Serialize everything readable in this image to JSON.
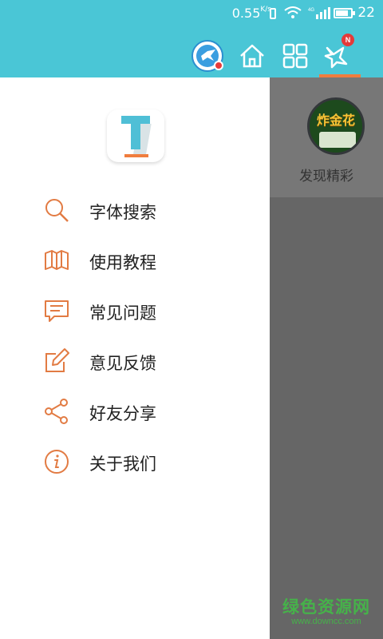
{
  "status_bar": {
    "speed_value": "0.55",
    "speed_unit": "K/s",
    "network_label": "4G",
    "time": "22"
  },
  "toolbar": {
    "icons": [
      "avatar-icon",
      "home-icon",
      "grid-icon",
      "notice-icon"
    ],
    "notice_badge": "N",
    "accent_color": "#f07d3e",
    "header_color": "#4ac6d6"
  },
  "drawer": {
    "logo_letter": "T",
    "items": [
      {
        "label": "字体搜索",
        "icon": "search-icon"
      },
      {
        "label": "使用教程",
        "icon": "book-icon"
      },
      {
        "label": "常见问题",
        "icon": "message-icon"
      },
      {
        "label": "意见反馈",
        "icon": "edit-icon"
      },
      {
        "label": "好友分享",
        "icon": "share-icon"
      },
      {
        "label": "关于我们",
        "icon": "info-icon"
      }
    ]
  },
  "background_panel": {
    "game_title": "炸金花",
    "discover_label": "发现精彩"
  },
  "watermark": {
    "main": "绿色资源网",
    "sub": "www.downcc.com"
  }
}
